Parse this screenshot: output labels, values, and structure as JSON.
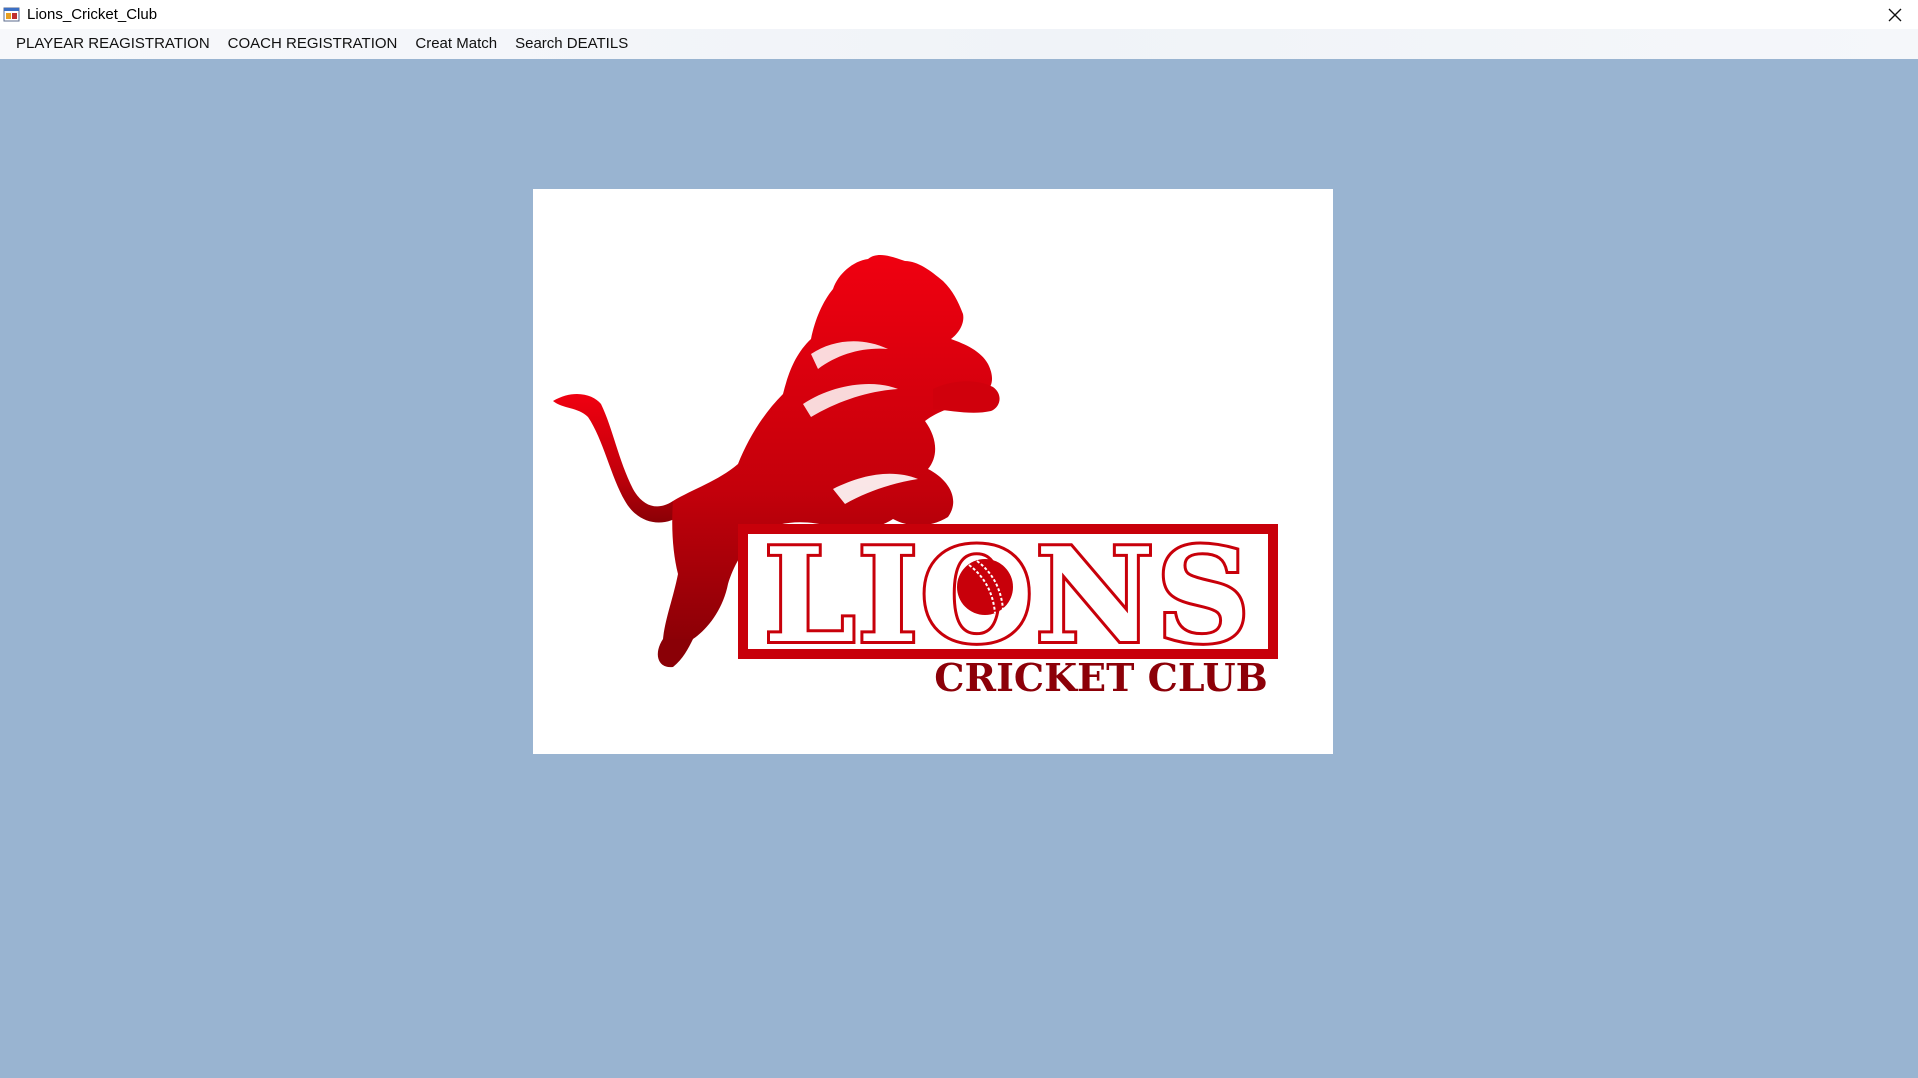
{
  "window": {
    "title": "Lions_Cricket_Club",
    "close_icon": "close-icon",
    "app_icon": "app-form-icon",
    "background_color": "#99b4d1"
  },
  "menu": {
    "items": [
      {
        "label": "PLAYEAR REAGISTRATION"
      },
      {
        "label": "COACH REGISTRATION"
      },
      {
        "label": "Creat Match"
      },
      {
        "label": "Search DEATILS"
      }
    ]
  },
  "logo": {
    "main_text": "LIONS",
    "sub_text": "CRICKET CLUB",
    "brand_color": "#c8000a",
    "dark_red": "#8c0008"
  }
}
